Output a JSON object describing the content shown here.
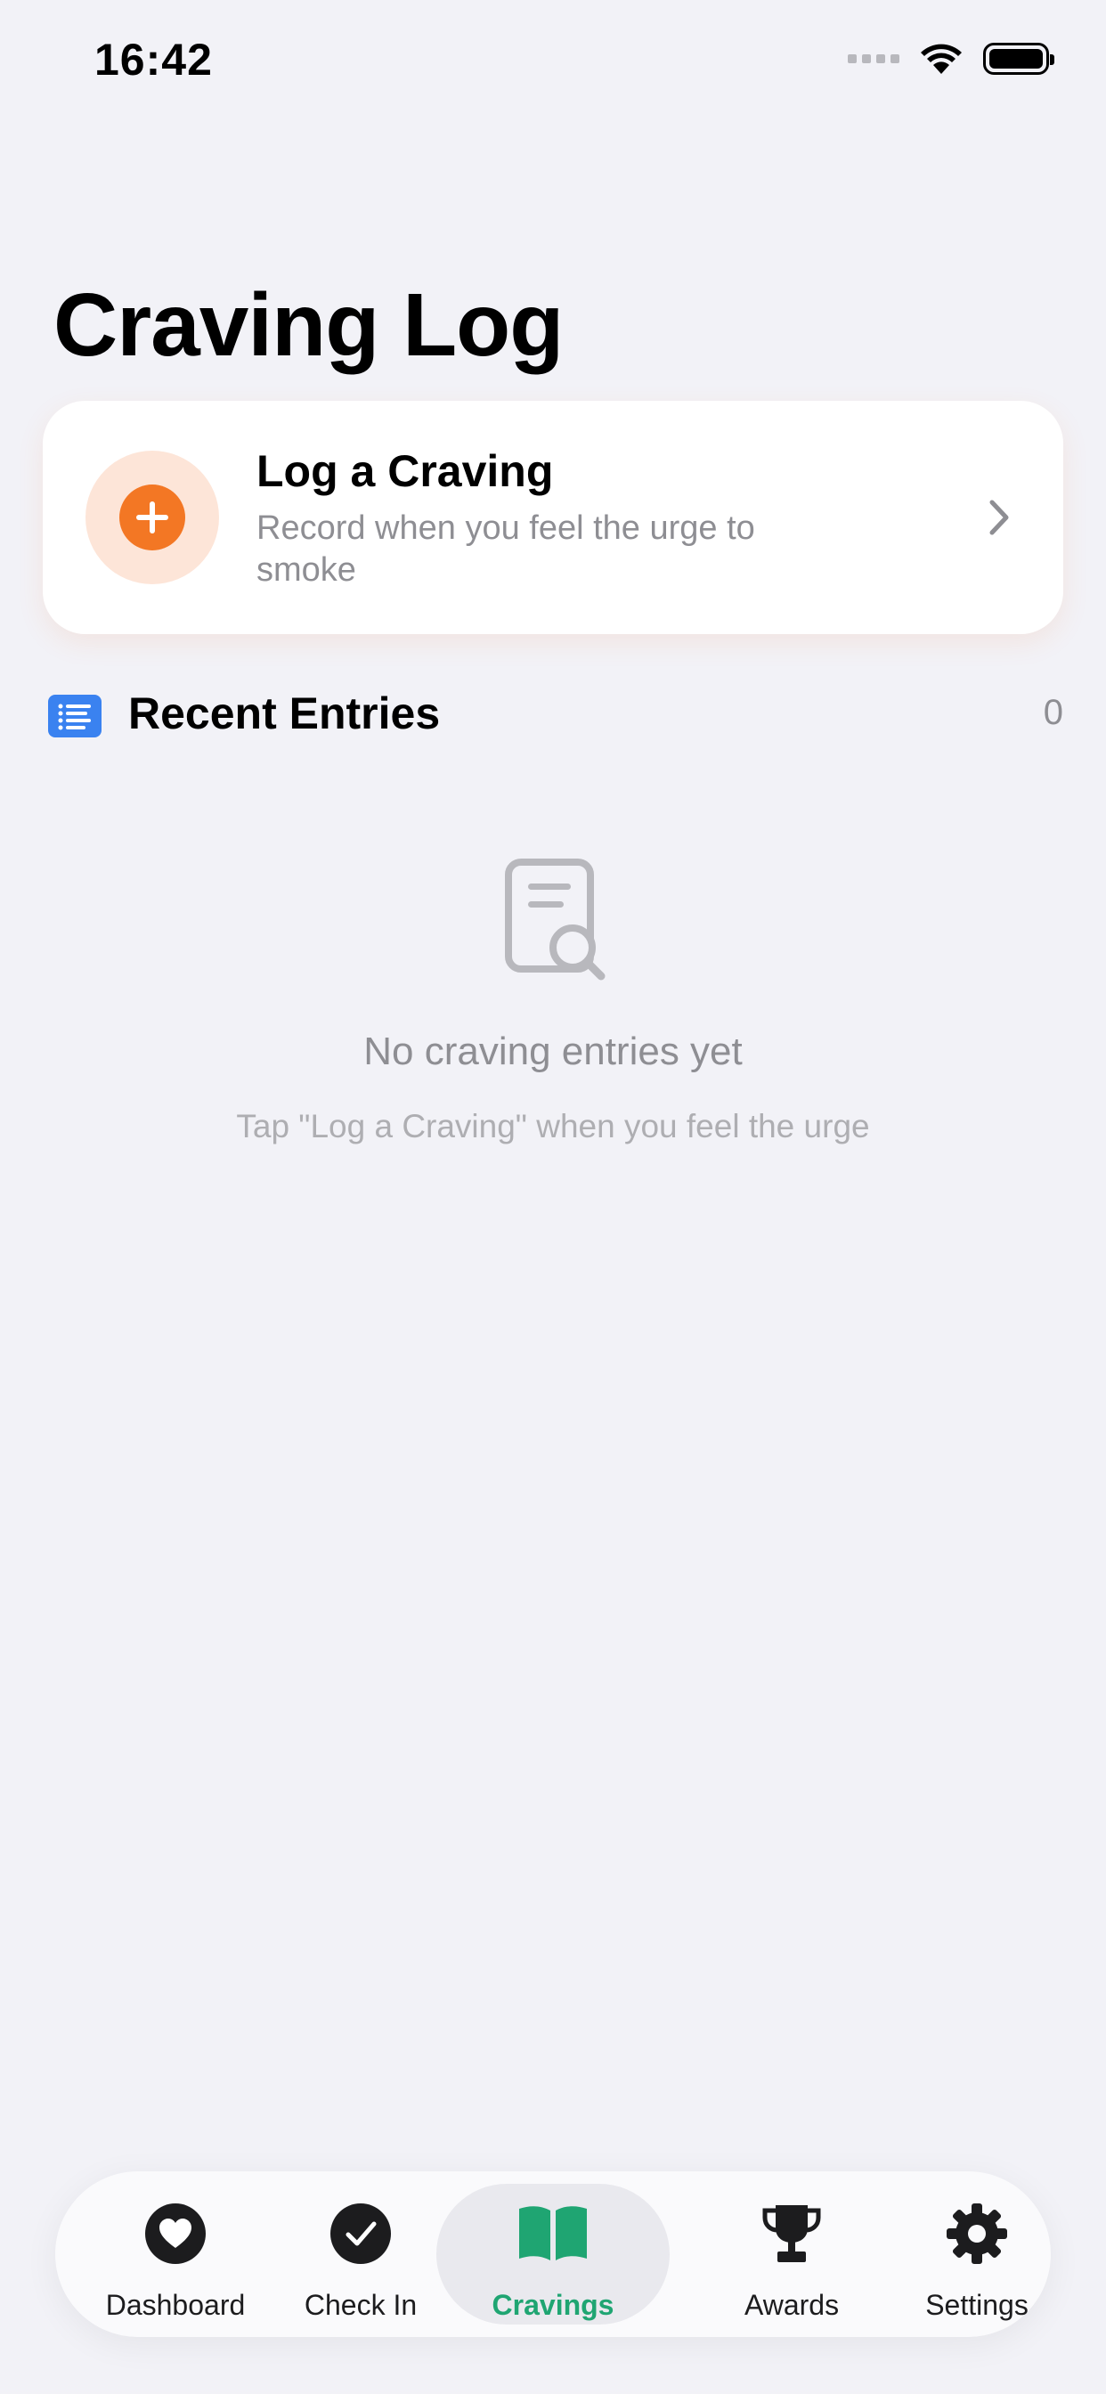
{
  "status_bar": {
    "time": "16:42"
  },
  "page": {
    "title": "Craving Log"
  },
  "log_card": {
    "title": "Log a Craving",
    "subtitle": "Record when you feel the urge to smoke",
    "icon": "plus-circle-icon",
    "accent_color": "#f37724"
  },
  "recent_entries": {
    "title": "Recent Entries",
    "count": "0",
    "icon": "list-icon",
    "icon_color": "#3a82f0"
  },
  "empty_state": {
    "icon": "document-search-icon",
    "title": "No craving entries yet",
    "hint": "Tap \"Log a Craving\" when you feel the urge"
  },
  "tab_bar": {
    "active_color": "#1fa572",
    "tabs": [
      {
        "label": "Dashboard",
        "icon": "heart-icon",
        "active": false
      },
      {
        "label": "Check In",
        "icon": "checkmark-circle-icon",
        "active": false
      },
      {
        "label": "Cravings",
        "icon": "book-icon",
        "active": true
      },
      {
        "label": "Awards",
        "icon": "trophy-icon",
        "active": false
      },
      {
        "label": "Settings",
        "icon": "gear-icon",
        "active": false
      }
    ]
  }
}
